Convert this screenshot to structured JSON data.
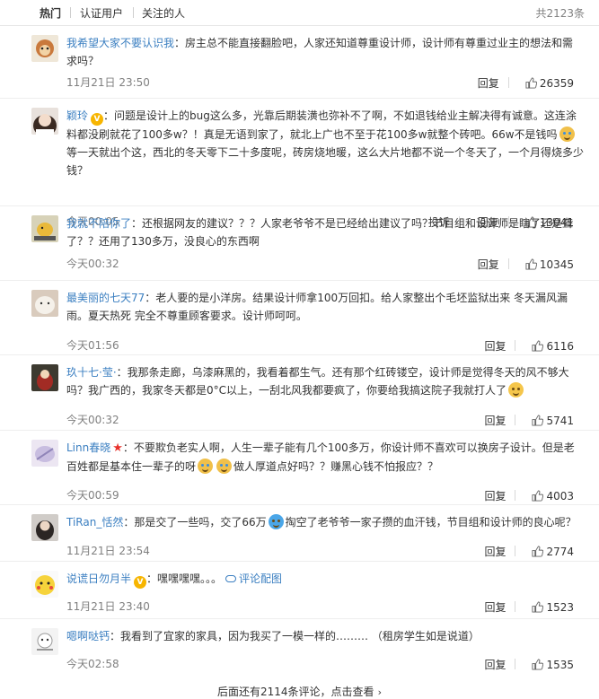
{
  "tabs": {
    "hot": "热门",
    "verified": "认证用户",
    "following": "关注的人"
  },
  "total_count": "共2123条",
  "actions": {
    "reply": "回复",
    "report": "投诉"
  },
  "comments": [
    {
      "user": "我希望大家不要认识我",
      "text": "：房主总不能直接翻脸吧，人家还知道尊重设计师，设计师有尊重过业主的想法和需求吗？",
      "time": "11月21日 23:50",
      "likes": "26359"
    },
    {
      "user": "颖玲",
      "text_a": "：问题是设计上的bug这么多，光靠后期装潢也弥补不了啊，不如退钱给业主解决得有诚意。这连涂料都没刷就花了100多w？！真是无语到家了，就北上广也不至于花100多w就整个砖吧。66w不是钱吗",
      "text_b": "等一天就出个这，西北的冬天零下二十多度呢，砖房烧地暖，这么大片地都不说一个冬天了，一个月得烧多少钱？",
      "time": "今天00:05",
      "likes": "13041"
    },
    {
      "user": "我就不陪你了",
      "text": "：还根据网友的建议？？？人家老爷爷不是已经给出建议了吗？节目组和设计师是瞎了还是聋了？？还用了130多万，没良心的东西啊",
      "time": "今天00:32",
      "likes": "10345"
    },
    {
      "user": "最美丽的七天77",
      "text": "：老人要的是小洋房。结果设计师拿100万回扣。给人家整出个毛坯监狱出来 冬天漏风漏雨。夏天热死 完全不尊重顾客要求。设计师呵呵。",
      "time": "今天01:56",
      "likes": "6116"
    },
    {
      "user": "玖十七·莹·",
      "text_a": "：我那条走廊，乌漆麻黑的，我看着都生气。还有那个红砖镂空，设计师是觉得冬天的风不够大吗？我广西的，我家冬天都是0°C以上，一刮北风我都要疯了，你要给我搞这院子我就打人了",
      "time": "今天00:32",
      "likes": "5741"
    },
    {
      "user": "Linn春晓",
      "text_a": "：不要欺负老实人啊，人生一辈子能有几个100多万，你设计师不喜欢可以换房子设计。但是老百姓都是基本住一辈子的呀",
      "text_b": "做人厚道点好吗？？赚黑心钱不怕报应？？",
      "time": "今天00:59",
      "likes": "4003"
    },
    {
      "user": "TiRan_恬然",
      "text_a": "：那是交了一些吗，交了66万",
      "text_b": "掏空了老爷爷一家子攒的血汗钱，节目组和设计师的良心呢？",
      "time": "11月21日 23:54",
      "likes": "2774"
    },
    {
      "user": "说谎日勿月半",
      "text": "：嘿嘿嘿嘿。。。",
      "link": "评论配图",
      "time": "11月21日 23:40",
      "likes": "1523"
    },
    {
      "user": "嗯啊哒钙",
      "text": "：我看到了宜家的家具，因为我买了一模一样的……… （租房学生如是说道）",
      "time": "今天02:58",
      "likes": "1535"
    }
  ],
  "more_text": "后面还有2114条评论，点击查看",
  "colors": {
    "link": "#3b7fc1",
    "meta": "#808080",
    "badge": "#f7b500"
  }
}
